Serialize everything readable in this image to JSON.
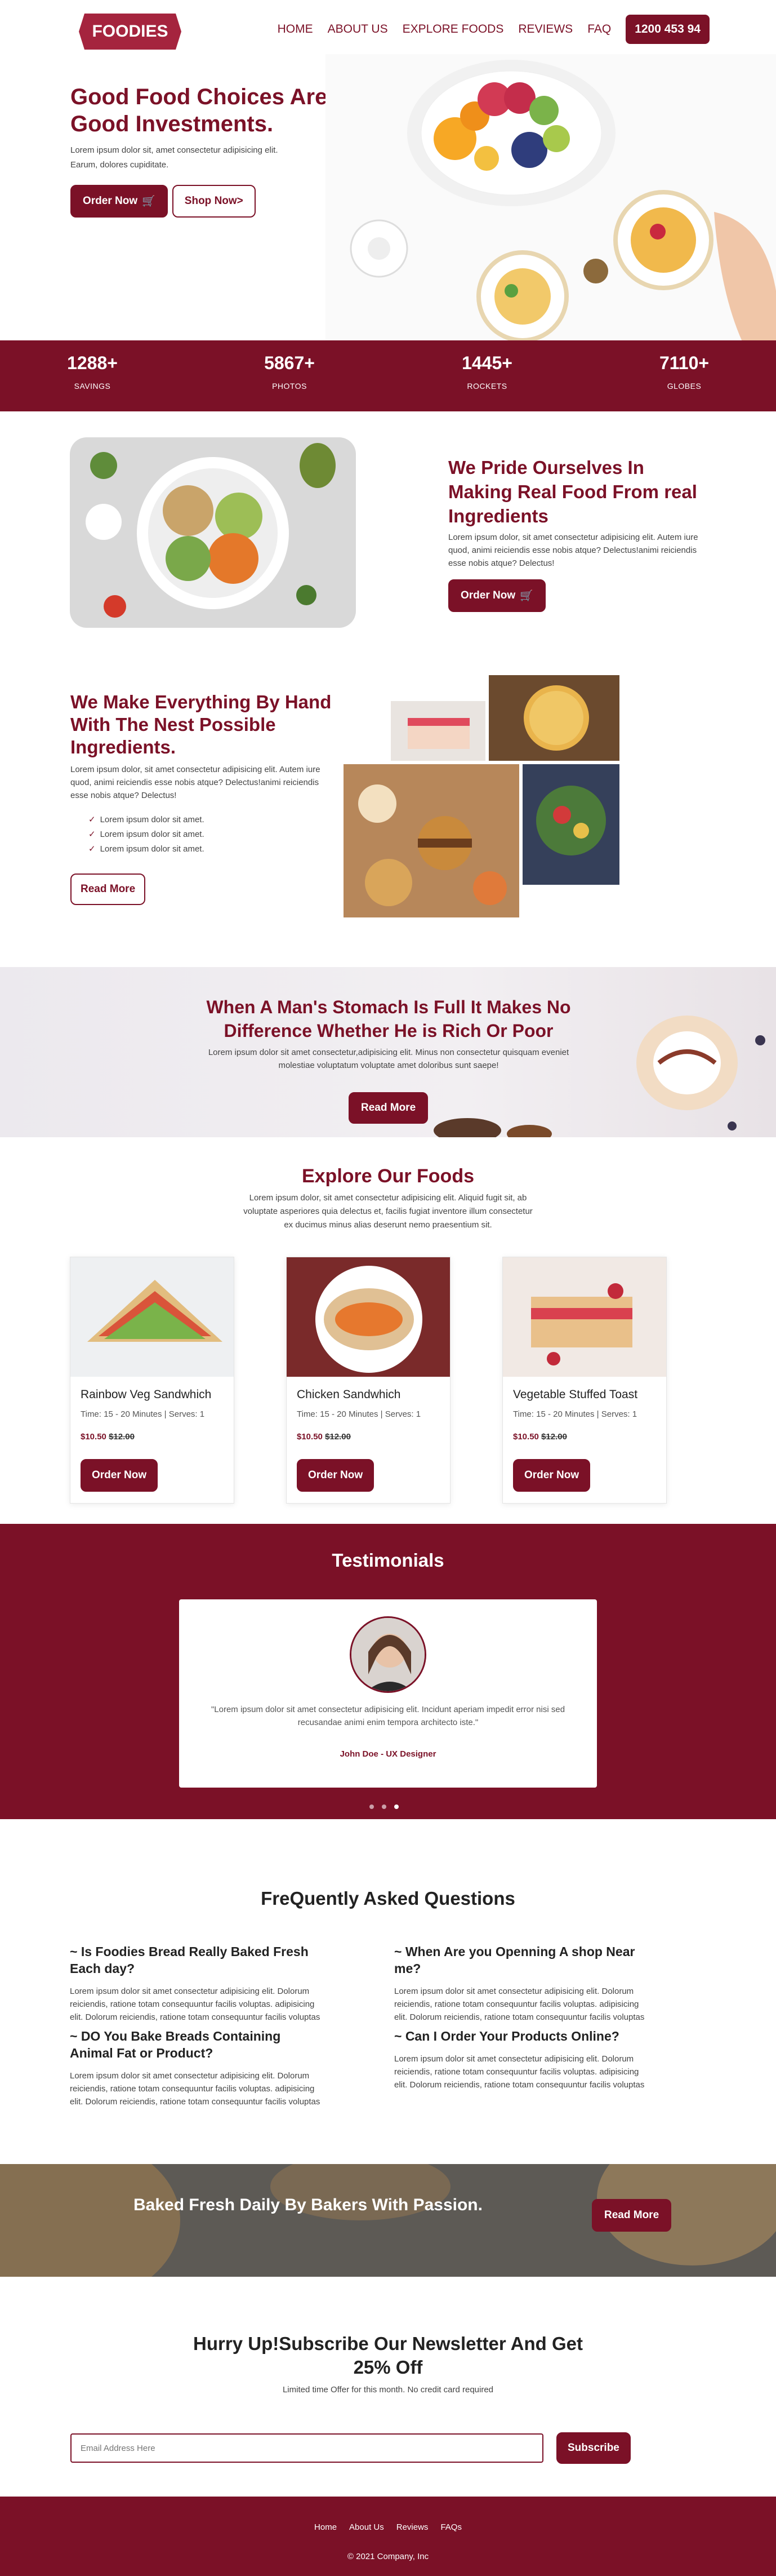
{
  "brand": {
    "logo": "FOODIES",
    "primary": "#7b1127"
  },
  "nav": {
    "items": [
      "HOME",
      "ABOUT US",
      "EXPLORE FOODS",
      "REVIEWS",
      "FAQ"
    ],
    "phone": "1200 453 94"
  },
  "hero": {
    "title": "Good Food Choices Are Good Investments.",
    "text": "Lorem ipsum dolor sit, amet consectetur adipisicing elit. Earum, dolores cupiditate.",
    "order_label": "Order Now",
    "shop_label": "Shop Now>"
  },
  "stats": [
    {
      "value": "1288+",
      "label": "SAVINGS"
    },
    {
      "value": "5867+",
      "label": "PHOTOS"
    },
    {
      "value": "1445+",
      "label": "ROCKETS"
    },
    {
      "value": "7110+",
      "label": "GLOBES"
    }
  ],
  "pride": {
    "title": "We Pride Ourselves In Making Real Food From real Ingredients",
    "text": "Lorem ipsum dolor, sit amet consectetur adipisicing elit. Autem iure quod, animi reiciendis esse nobis atque? Delectus!animi reiciendis esse nobis atque? Delectus!",
    "button": "Order Now"
  },
  "hand": {
    "title": "We Make Everything By Hand With The Nest Possible Ingredients.",
    "text": "Lorem ipsum dolor, sit amet consectetur adipisicing elit. Autem iure quod, animi reiciendis esse nobis atque? Delectus!animi reiciendis esse nobis atque? Delectus!",
    "list": [
      "Lorem ipsum dolor sit amet.",
      "Lorem ipsum dolor sit amet.",
      "Lorem ipsum dolor sit amet."
    ],
    "button": "Read More"
  },
  "banner": {
    "title": "When A Man's Stomach Is Full It Makes No Difference Whether He is Rich Or Poor",
    "text": "Lorem ipsum dolor sit amet consectetur,adipisicing elit. Minus non consectetur quisquam eveniet molestiae voluptatum voluptate amet doloribus sunt saepe!",
    "button": "Read More"
  },
  "explore": {
    "title": "Explore Our Foods",
    "text": "Lorem ipsum dolor, sit amet consectetur adipisicing elit. Aliquid fugit sit, ab voluptate asperiores quia delectus et, facilis fugiat inventore illum consectetur ex ducimus minus alias deserunt nemo praesentium sit.",
    "cards": [
      {
        "name": "Rainbow Veg Sandwhich",
        "meta": "Time: 15 - 20 Minutes | Serves: 1",
        "price": "$10.50",
        "old": "$12.00",
        "button": "Order Now"
      },
      {
        "name": "Chicken Sandwhich",
        "meta": "Time: 15 - 20 Minutes | Serves: 1",
        "price": "$10.50",
        "old": "$12.00",
        "button": "Order Now"
      },
      {
        "name": "Vegetable Stuffed Toast",
        "meta": "Time: 15 - 20 Minutes | Serves: 1",
        "price": "$10.50",
        "old": "$12.00",
        "button": "Order Now"
      }
    ]
  },
  "testimonials": {
    "title": "Testimonials",
    "quote": "\"Lorem ipsum dolor sit amet consectetur adipisicing elit. Incidunt aperiam impedit error nisi sed recusandae animi enim tempora architecto iste.\"",
    "name": "John Doe - UX Designer"
  },
  "faq": {
    "title": "FreQuently Asked Questions",
    "items": [
      {
        "q": "~ Is Foodies Bread Really Baked Fresh Each day?",
        "a": "Lorem ipsum dolor sit amet consectetur adipisicing elit. Dolorum reiciendis, ratione totam consequuntur facilis voluptas. adipisicing elit. Dolorum reiciendis, ratione totam consequuntur facilis voluptas"
      },
      {
        "q": "~ When Are you Openning A shop Near me?",
        "a": "Lorem ipsum dolor sit amet consectetur adipisicing elit. Dolorum reiciendis, ratione totam consequuntur facilis voluptas. adipisicing elit. Dolorum reiciendis, ratione totam consequuntur facilis voluptas"
      },
      {
        "q": "~ DO You Bake Breads Containing Animal Fat or Product?",
        "a": "Lorem ipsum dolor sit amet consectetur adipisicing elit. Dolorum reiciendis, ratione totam consequuntur facilis voluptas. adipisicing elit. Dolorum reiciendis, ratione totam consequuntur facilis voluptas"
      },
      {
        "q": "~ Can I Order Your Products Online?",
        "a": "Lorem ipsum dolor sit amet consectetur adipisicing elit. Dolorum reiciendis, ratione totam consequuntur facilis voluptas. adipisicing elit. Dolorum reiciendis, ratione totam consequuntur facilis voluptas"
      }
    ]
  },
  "baked": {
    "title": "Baked Fresh Daily By Bakers With Passion.",
    "button": "Read More"
  },
  "newsletter": {
    "title": "Hurry Up!Subscribe Our Newsletter And Get 25% Off",
    "subtitle": "Limited time Offer for this month. No credit card required",
    "placeholder": "Email Address Here",
    "button": "Subscribe"
  },
  "footer": {
    "links": [
      "Home",
      "About Us",
      "Reviews",
      "FAQs"
    ],
    "copyright": "© 2021 Company, Inc"
  }
}
